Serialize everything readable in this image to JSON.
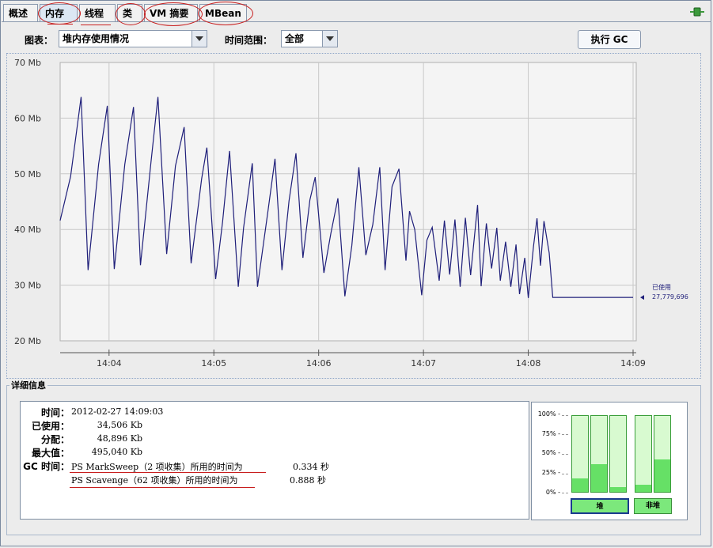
{
  "tabs": [
    {
      "label": "概述"
    },
    {
      "label": "内存",
      "active": true
    },
    {
      "label": "线程"
    },
    {
      "label": "类"
    },
    {
      "label": "VM 摘要"
    },
    {
      "label": "MBean"
    }
  ],
  "toolbar": {
    "chart_label": "图表：",
    "chart_value": "堆内存使用情况",
    "range_label": "时间范围：",
    "range_value": "全部",
    "gc_button": "执行 GC"
  },
  "chart_data": {
    "type": "line",
    "ylim": [
      20,
      70
    ],
    "yticks": [
      20,
      30,
      40,
      50,
      60,
      70
    ],
    "ytick_labels": [
      "20 Mb",
      "30 Mb",
      "40 Mb",
      "50 Mb",
      "60 Mb",
      "70 Mb"
    ],
    "xlim": [
      "14:03:32",
      "14:09:00"
    ],
    "xticks": [
      "14:04",
      "14:05",
      "14:06",
      "14:07",
      "14:08",
      "14:09"
    ],
    "series": [
      {
        "name": "已使用",
        "color": "#1F1F7A",
        "x": [
          "14:03:32",
          "14:03:38",
          "14:03:44",
          "14:03:48",
          "14:03:54",
          "14:03:59",
          "14:04:03",
          "14:04:09",
          "14:04:14",
          "14:04:18",
          "14:04:24",
          "14:04:28",
          "14:04:33",
          "14:04:38",
          "14:04:43",
          "14:04:47",
          "14:04:53",
          "14:04:56",
          "14:05:01",
          "14:05:05",
          "14:05:09",
          "14:05:14",
          "14:05:17",
          "14:05:22",
          "14:05:25",
          "14:05:31",
          "14:05:35",
          "14:05:39",
          "14:05:43",
          "14:05:47",
          "14:05:51",
          "14:05:55",
          "14:05:58",
          "14:06:03",
          "14:06:07",
          "14:06:11",
          "14:06:15",
          "14:06:19",
          "14:06:23",
          "14:06:27",
          "14:06:31",
          "14:06:35",
          "14:06:38",
          "14:06:42",
          "14:06:46",
          "14:06:50",
          "14:06:52",
          "14:06:55",
          "14:06:59",
          "14:07:02",
          "14:07:05",
          "14:07:09",
          "14:07:12",
          "14:07:15",
          "14:07:18",
          "14:07:21",
          "14:07:24",
          "14:07:27",
          "14:07:31",
          "14:07:33",
          "14:07:36",
          "14:07:39",
          "14:07:42",
          "14:07:44",
          "14:07:47",
          "14:07:50",
          "14:07:53",
          "14:07:55",
          "14:07:58",
          "14:08:00",
          "14:08:03",
          "14:08:05",
          "14:08:07",
          "14:08:09",
          "14:08:12",
          "14:08:14",
          "14:08:16",
          "14:08:18",
          "14:08:21",
          "14:08:25",
          "14:08:29",
          "14:08:33",
          "14:08:35",
          "14:08:38",
          "14:08:42",
          "14:08:46",
          "14:08:48",
          "14:08:52",
          "14:08:54",
          "14:08:58",
          "14:09:00"
        ],
        "y": [
          41.6,
          49.5,
          63.8,
          32.7,
          51.7,
          62.2,
          32.9,
          51.7,
          62.0,
          33.6,
          52.1,
          63.8,
          35.6,
          51.4,
          58.4,
          33.9,
          49.1,
          54.7,
          31.1,
          41.4,
          54.1,
          29.7,
          40.3,
          51.9,
          29.7,
          43.4,
          52.7,
          32.7,
          45.1,
          53.7,
          34.9,
          45.3,
          49.4,
          32.2,
          39.3,
          45.6,
          28.0,
          37.1,
          51.2,
          35.4,
          40.9,
          51.2,
          32.7,
          47.7,
          50.9,
          34.4,
          43.3,
          40.0,
          28.2,
          38.1,
          40.4,
          30.8,
          41.6,
          31.9,
          41.8,
          29.7,
          42.1,
          31.8,
          44.4,
          29.8,
          41.1,
          33.0,
          40.3,
          30.8,
          37.8,
          29.7,
          37.3,
          28.4,
          34.9,
          27.7,
          37.0,
          42.0,
          33.5,
          41.5,
          35.8,
          27.8,
          27.8,
          27.8,
          27.8,
          27.8,
          27.8,
          27.8,
          27.8,
          27.8,
          27.8,
          27.8,
          27.8,
          27.8,
          27.8,
          27.8,
          27.8
        ],
        "last_label": "已使用",
        "last_value": "27,779,696"
      }
    ]
  },
  "details": {
    "title": "详细信息",
    "rows": [
      {
        "key": "时间：",
        "value": "2012-02-27 14:09:03"
      },
      {
        "key": "已使用：",
        "value": "34,506 Kb"
      },
      {
        "key": "分配：",
        "value": "48,896 Kb"
      },
      {
        "key": "最大值：",
        "value": "495,040 Kb"
      }
    ],
    "gc_key": "GC 时间：",
    "gc": [
      {
        "label": "PS MarkSweep（2 项收集）所用的时间为",
        "value": "0.334 秒"
      },
      {
        "label": "PS Scavenge（62 项收集）所用的时间为",
        "value": "0.888 秒"
      }
    ]
  },
  "pools": {
    "percent_labels": [
      "100% -",
      "75% -",
      "50% -",
      "25% -",
      "0% -"
    ],
    "heap_label": "堆",
    "nonheap_label": "非堆",
    "heap_bars": [
      0.18,
      0.36,
      0.06
    ],
    "nonheap_bars": [
      0.09,
      0.43
    ]
  }
}
